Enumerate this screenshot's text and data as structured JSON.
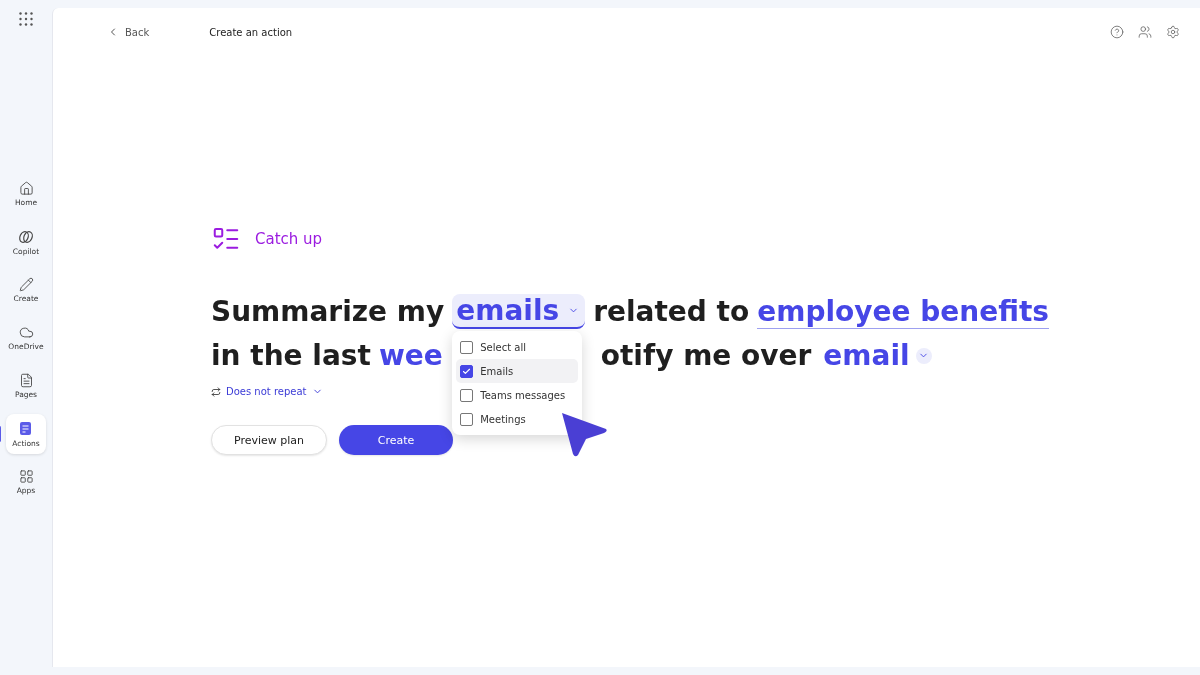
{
  "sidebar": {
    "items": [
      {
        "label": "Home",
        "selected": false
      },
      {
        "label": "Copilot",
        "selected": false
      },
      {
        "label": "Create",
        "selected": false
      },
      {
        "label": "OneDrive",
        "selected": false
      },
      {
        "label": "Pages",
        "selected": false
      },
      {
        "label": "Actions",
        "selected": true
      },
      {
        "label": "Apps",
        "selected": false
      }
    ]
  },
  "header": {
    "back": "Back",
    "title": "Create an action"
  },
  "template": {
    "label": "Catch up"
  },
  "prompt": {
    "line1": [
      {
        "kind": "text",
        "text": "Summarize my"
      },
      {
        "kind": "dropdown",
        "text": "emails",
        "open": true
      },
      {
        "kind": "text",
        "text": "related to"
      },
      {
        "kind": "entry",
        "text": "employee benefits"
      }
    ],
    "line2": [
      {
        "kind": "text",
        "text": "in the last"
      },
      {
        "kind": "entry",
        "text": "wee",
        "gap": true
      },
      {
        "kind": "text",
        "text": "otify me over"
      },
      {
        "kind": "dropdown",
        "text": "email",
        "open": false
      }
    ]
  },
  "menu": {
    "options": [
      {
        "label": "Select all",
        "checked": false,
        "highlighted": false
      },
      {
        "label": "Emails",
        "checked": true,
        "highlighted": true
      },
      {
        "label": "Teams messages",
        "checked": false,
        "highlighted": false
      },
      {
        "label": "Meetings",
        "checked": false,
        "highlighted": false
      }
    ]
  },
  "repeat": {
    "label": "Does not repeat"
  },
  "buttons": [
    {
      "label": "Preview plan",
      "kind": "secondary"
    },
    {
      "label": "Create",
      "kind": "primary"
    }
  ]
}
